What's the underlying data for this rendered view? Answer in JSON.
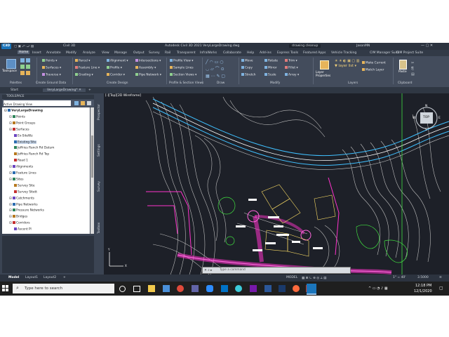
{
  "titlebar": {
    "app_menu": "C3D",
    "product": "Civil 3D",
    "title": "Autodesk Civil 3D 2021   VeryLargeDrawing.dwg",
    "search_hint": "drawing cleanup",
    "user": "JasonMN"
  },
  "menu_tabs": [
    "Home",
    "Insert",
    "Annotate",
    "Modify",
    "Analyze",
    "View",
    "Manage",
    "Output",
    "Survey",
    "Rail",
    "Transparent",
    "InfraWorks",
    "Collaborate",
    "Help",
    "Add-ins",
    "Express Tools",
    "Featured Apps",
    "Vehicle Tracking",
    "CIM Manager Suite",
    "CIM Project Suite"
  ],
  "ribbon": {
    "toolspace": "Toolspace",
    "palettes": "Palettes",
    "ground": [
      "Points",
      "Surfaces",
      "Traverse"
    ],
    "ground_title": "Create Ground Data",
    "design_col1": [
      "Parcel",
      "Feature Line",
      "Grading"
    ],
    "design_col2": [
      "Alignment",
      "Profile",
      "Corridor"
    ],
    "design_col3": [
      "Intersections",
      "Assembly",
      "Pipe Network"
    ],
    "design_title": "Create Design",
    "views": [
      "Profile View",
      "Sample Lines",
      "Section Views"
    ],
    "views_title": "Profile & Section Views",
    "draw_title": "Draw",
    "modify_col1": [
      "Move",
      "Copy",
      "Stretch"
    ],
    "modify_col2": [
      "Rotate",
      "Mirror",
      "Scale"
    ],
    "modify_col3": [
      "Trim",
      "Fillet",
      "Array"
    ],
    "modify_title": "Modify",
    "layer_properties": "Layer Properties",
    "layers_col": [
      "Make Current",
      "Match Layer"
    ],
    "layers_title": "Layers",
    "paste": "Paste",
    "clipboard_title": "Clipboard"
  },
  "file_tabs": [
    "Start",
    "VeryLargeDrawing*"
  ],
  "toolspace": {
    "header": "TOOLSPACE",
    "view": "Active Drawing View",
    "tree": [
      {
        "label": "VeryLargeDrawing",
        "level": 0,
        "bold": true
      },
      {
        "label": "Points",
        "level": 1
      },
      {
        "label": "Point Groups",
        "level": 1
      },
      {
        "label": "Surfaces",
        "level": 1
      },
      {
        "label": "Ex-SiteWz",
        "level": 2
      },
      {
        "label": "Existing Site",
        "level": 2,
        "selected": true
      },
      {
        "label": "Jeffries Ranch Rd Datum",
        "level": 2
      },
      {
        "label": "Jeffries Ranch Rd Top",
        "level": 2
      },
      {
        "label": "Road 1",
        "level": 2
      },
      {
        "label": "Alignments",
        "level": 1
      },
      {
        "label": "Feature Lines",
        "level": 1
      },
      {
        "label": "Sites",
        "level": 1
      },
      {
        "label": "Survey Site",
        "level": 2
      },
      {
        "label": "Survey Sitett",
        "level": 2
      },
      {
        "label": "Catchments",
        "level": 1
      },
      {
        "label": "Pipe Networks",
        "level": 1
      },
      {
        "label": "Pressure Networks",
        "level": 1
      },
      {
        "label": "Bridges",
        "level": 1
      },
      {
        "label": "Corridors",
        "level": 1
      },
      {
        "label": "Ascent Pl",
        "level": 2
      }
    ]
  },
  "side_tabs": [
    "Prospector",
    "Settings",
    "Survey",
    "Toolbox"
  ],
  "viewport": {
    "label": "[-][Top][2D Wireframe]",
    "compass": {
      "n": "N",
      "s": "S",
      "e": "E",
      "w": "W",
      "top": "TOP"
    },
    "command_hint": "Type a command"
  },
  "layout_tabs": [
    "Model",
    "Layout1",
    "Layout2"
  ],
  "statusbar": {
    "model": "MODEL",
    "scale": "1\" = 40'",
    "value": "3.5000"
  },
  "taskbar": {
    "search_placeholder": "Type here to search",
    "time": "12:18 PM",
    "date": "12/1/2020"
  },
  "colors": {
    "accent": "#1b75bb",
    "road_magenta": "#ff33cc",
    "contour": "#c8c8c8",
    "alignment_cyan": "#40c0ff"
  }
}
